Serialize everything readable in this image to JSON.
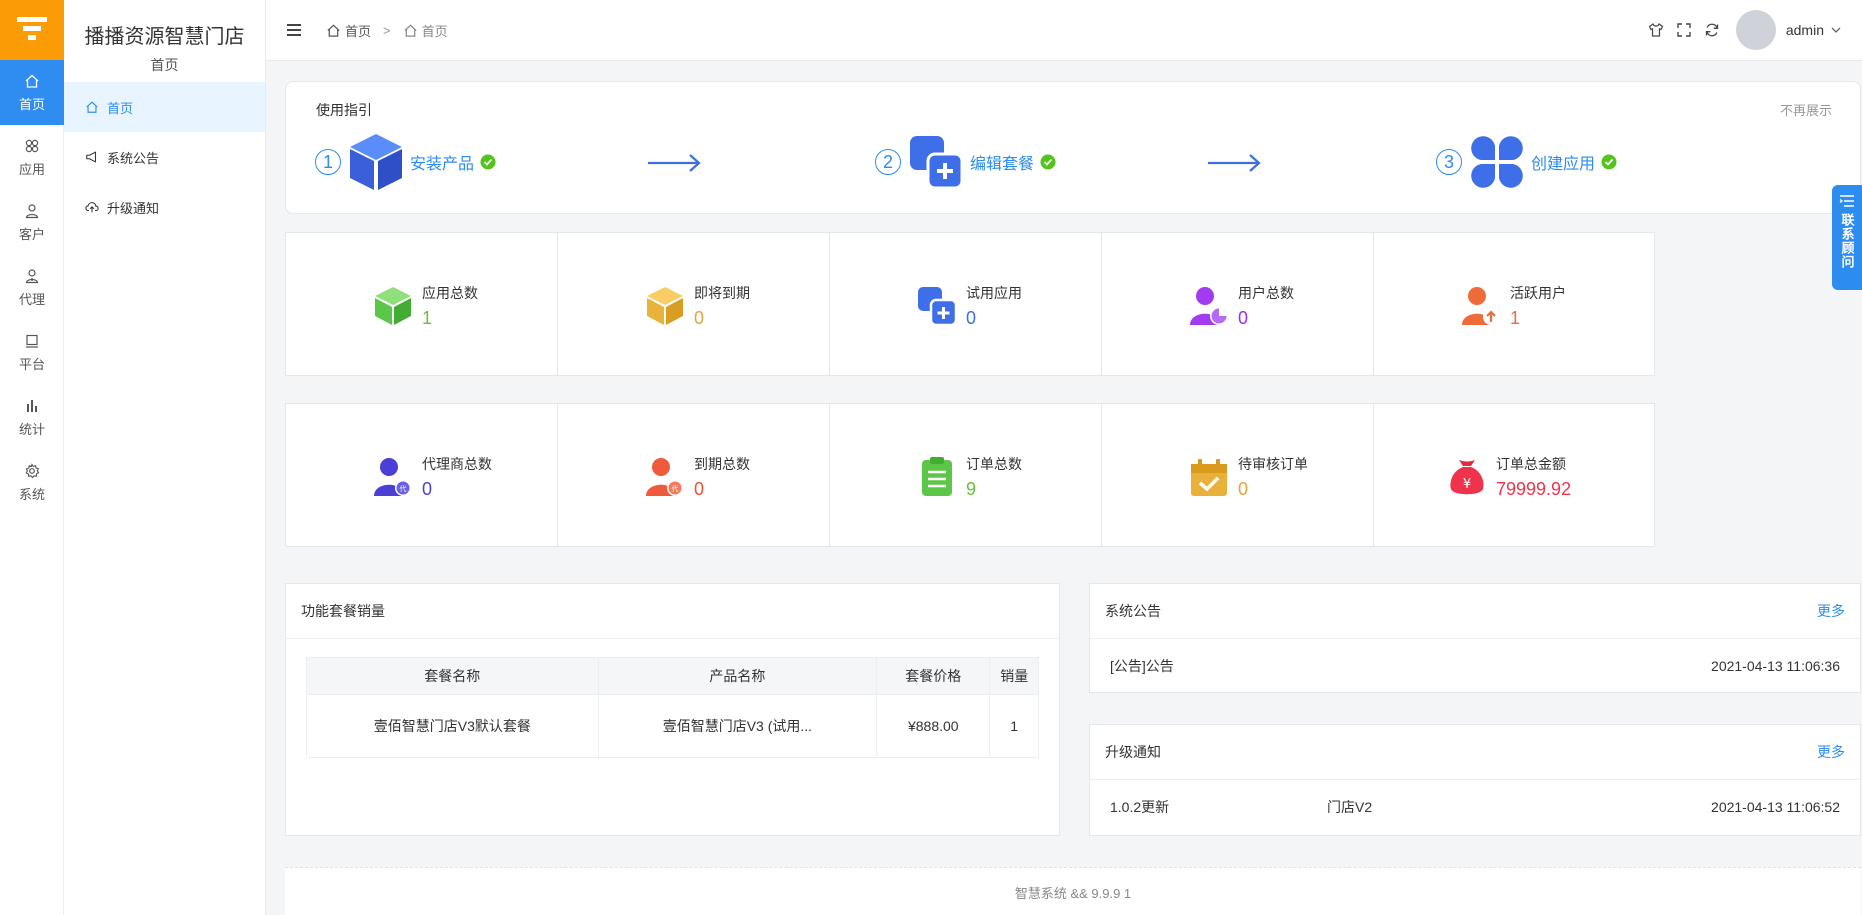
{
  "rail": [
    {
      "label": "首页",
      "icon": "home-icon"
    },
    {
      "label": "应用",
      "icon": "apps-icon"
    },
    {
      "label": "客户",
      "icon": "user-icon"
    },
    {
      "label": "代理",
      "icon": "agent-icon"
    },
    {
      "label": "平台",
      "icon": "platform-icon"
    },
    {
      "label": "统计",
      "icon": "stats-icon"
    },
    {
      "label": "系统",
      "icon": "settings-icon"
    }
  ],
  "subnav": {
    "title": "播播资源智慧门店",
    "subtitle": "首页",
    "items": [
      {
        "label": "首页",
        "icon": "home-icon"
      },
      {
        "label": "系统公告",
        "icon": "megaphone-icon"
      },
      {
        "label": "升级通知",
        "icon": "cloud-upload-icon"
      }
    ]
  },
  "breadcrumb": {
    "first": "首页",
    "separator": ">",
    "second": "首页"
  },
  "user": {
    "name": "admin"
  },
  "guide": {
    "title": "使用指引",
    "hide_label": "不再展示",
    "steps": [
      {
        "num": "1",
        "label": "安装产品",
        "icon": "cube-icon"
      },
      {
        "num": "2",
        "label": "编辑套餐",
        "icon": "package-edit-icon"
      },
      {
        "num": "3",
        "label": "创建应用",
        "icon": "clover-icon"
      }
    ]
  },
  "stats": [
    {
      "label": "应用总数",
      "value": "1",
      "color": "#67c23a",
      "icon": "cube-green-icon"
    },
    {
      "label": "即将到期",
      "value": "0",
      "color": "#e6a23c",
      "icon": "cube-yellow-icon"
    },
    {
      "label": "试用应用",
      "value": "0",
      "color": "#3e6fe8",
      "icon": "trial-app-icon"
    },
    {
      "label": "用户总数",
      "value": "0",
      "color": "#9c2cf0",
      "icon": "user-pie-icon"
    },
    {
      "label": "活跃用户",
      "value": "1",
      "color": "#ef6b3a",
      "icon": "active-user-icon"
    },
    {
      "label": "代理商总数",
      "value": "0",
      "color": "#4b3fd6",
      "icon": "agent-purple-icon"
    },
    {
      "label": "到期总数",
      "value": "0",
      "color": "#ef4e34",
      "icon": "agent-orange-icon"
    },
    {
      "label": "订单总数",
      "value": "9",
      "color": "#67c23a",
      "icon": "clipboard-icon"
    },
    {
      "label": "待审核订单",
      "value": "0",
      "color": "#e6a23c",
      "icon": "pending-order-icon"
    },
    {
      "label": "订单总金额",
      "value": "79999.92",
      "color": "#f0334d",
      "icon": "money-bag-icon"
    }
  ],
  "sales": {
    "title": "功能套餐销量",
    "columns": [
      "套餐名称",
      "产品名称",
      "套餐价格",
      "销量"
    ],
    "rows": [
      [
        "壹佰智慧门店V3默认套餐",
        "壹佰智慧门店V3 (试用...",
        "¥888.00",
        "1"
      ]
    ]
  },
  "notices": {
    "title": "系统公告",
    "more": "更多",
    "items": [
      {
        "text": "[公告]公告",
        "time": "2021-04-13 11:06:36"
      }
    ]
  },
  "upgrades": {
    "title": "升级通知",
    "more": "更多",
    "items": [
      {
        "version": "1.0.2更新",
        "product": "门店V2",
        "time": "2021-04-13 11:06:52"
      }
    ]
  },
  "footer": "智慧系统 && 9.9.9 1",
  "float_tab": "联系顾问",
  "colors": {
    "accent": "#2d8cf0",
    "logo": "#fb9b06"
  }
}
